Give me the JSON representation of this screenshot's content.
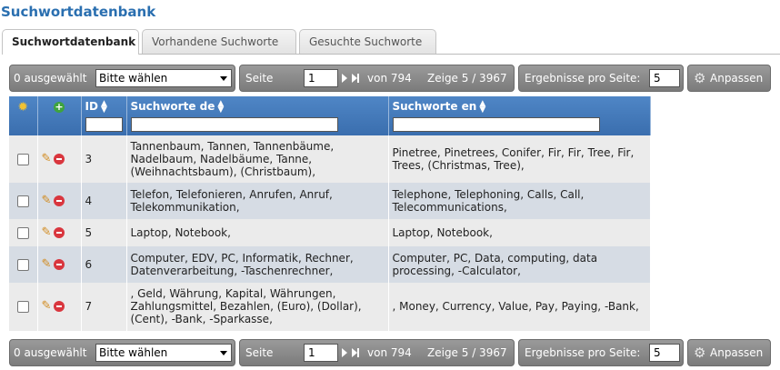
{
  "page_title": "Suchwortdatenbank",
  "tabs": [
    {
      "label": "Suchwortdatenbank",
      "active": true
    },
    {
      "label": "Vorhandene Suchworte",
      "active": false
    },
    {
      "label": "Gesuchte Suchworte",
      "active": false
    }
  ],
  "toolbar": {
    "selected_count": "0 ausgewählt",
    "bulk_action_value": "Bitte wählen",
    "page_label": "Seite",
    "page_value": "1",
    "of_pages": "von 794",
    "showing": "Zeige 5 / 3967",
    "per_page_label": "Ergebnisse pro Seite:",
    "per_page_value": "5",
    "customize_label": "Anpassen"
  },
  "table": {
    "headers": {
      "id": "ID",
      "de": "Suchworte de",
      "en": "Suchworte en"
    },
    "rows": [
      {
        "id": "3",
        "de": "Tannenbaum, Tannen, Tannenbäume, Nadelbaum, Nadelbäume, Tanne, (Weihnachtsbaum), (Christbaum),",
        "en": "Pinetree, Pinetrees, Conifer, Fir, Fir, Tree, Fir, Trees, (Christmas, Tree),"
      },
      {
        "id": "4",
        "de": "Telefon, Telefonieren, Anrufen, Anruf, Telekommunikation,",
        "en": "Telephone, Telephoning, Calls, Call, Telecommunications,"
      },
      {
        "id": "5",
        "de": "Laptop, Notebook,",
        "en": "Laptop, Notebook,"
      },
      {
        "id": "6",
        "de": "Computer, EDV, PC, Informatik, Rechner, Datenverarbeitung, -Taschenrechner,",
        "en": "Computer, PC, Data, computing, data processing, -Calculator,"
      },
      {
        "id": "7",
        "de": ", Geld, Währung, Kapital, Währungen, Zahlungsmittel, Bezahlen, (Euro), (Dollar), (Cent), -Bank, -Sparkasse,",
        "en": ", Money, Currency, Value, Pay, Paying, -Bank,"
      }
    ]
  },
  "icons": {
    "header_col1": "sun-icon",
    "header_col2": "add-icon",
    "row_edit": "pencil-icon",
    "row_delete": "delete-icon",
    "settings": "gear-icon"
  },
  "colors": {
    "title": "#2a6fb0",
    "header_bg": "#3f78b8",
    "toolbar_bg": "#878787",
    "row_odd": "#ebebeb",
    "row_even": "#d6dce4",
    "delete": "#d9363e",
    "add": "#3ea33e"
  }
}
